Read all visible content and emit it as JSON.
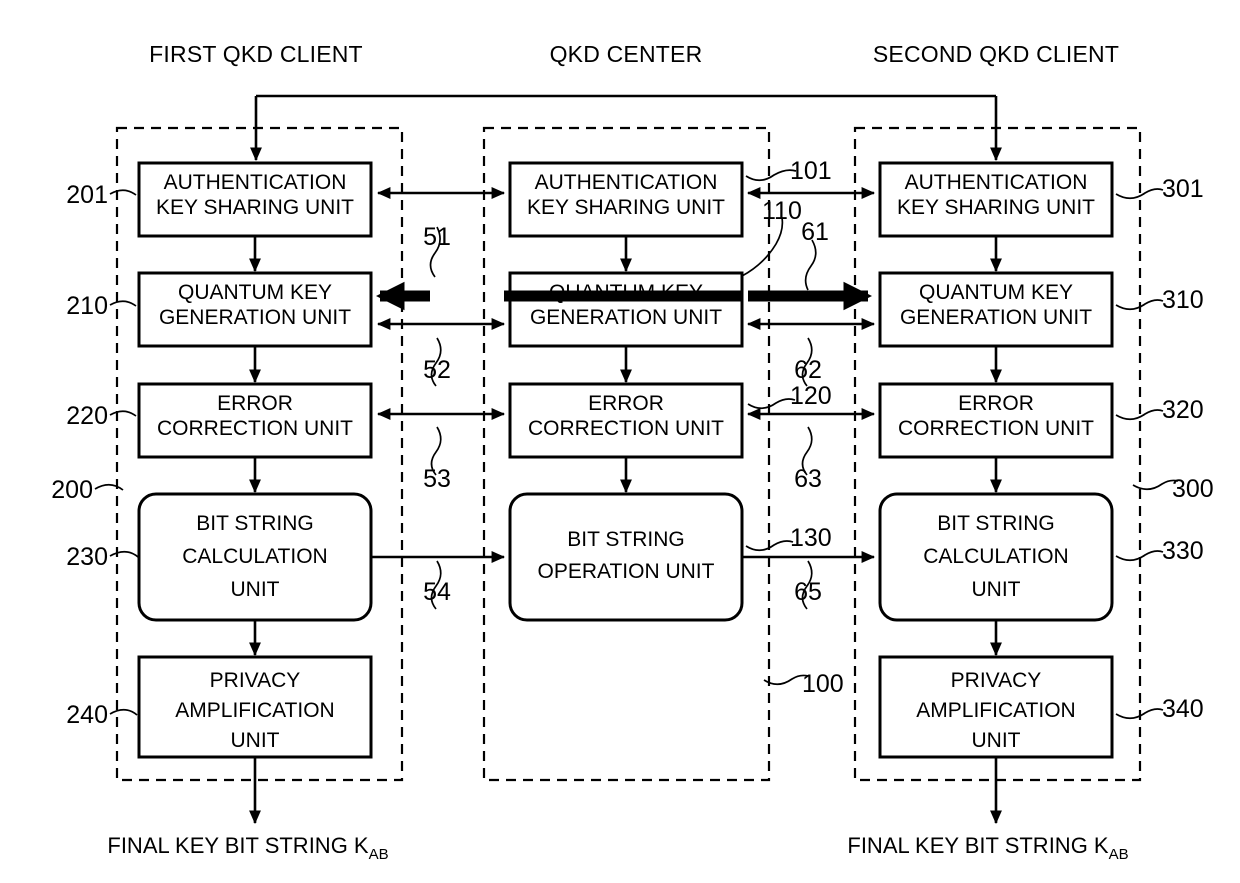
{
  "figure": {
    "title": "QKD system block diagram",
    "columns": [
      {
        "id": "first-client",
        "header": "FIRST QKD CLIENT"
      },
      {
        "id": "qkd-center",
        "header": "QKD CENTER"
      },
      {
        "id": "second-client",
        "header": "SECOND QKD CLIENT"
      }
    ],
    "units": {
      "auth_key_sharing": "AUTHENTICATION\nKEY SHARING UNIT",
      "auth_line1": "AUTHENTICATION",
      "auth_line2": "KEY SHARING UNIT",
      "quantum_line1": "QUANTUM KEY",
      "quantum_line2": "GENERATION UNIT",
      "error_line1": "ERROR",
      "error_line2": "CORRECTION UNIT",
      "bitcalc_line1": "BIT STRING",
      "bitcalc_line2": "CALCULATION",
      "bitcalc_line3": "UNIT",
      "bitop_line1": "BIT STRING",
      "bitop_line2": "OPERATION UNIT",
      "privacy_line1": "PRIVACY",
      "privacy_line2": "AMPLIFICATION",
      "privacy_line3": "UNIT"
    },
    "reference_numerals": {
      "left_client_group": "200",
      "left_auth": "201",
      "left_quantum": "210",
      "left_error": "220",
      "left_bitcalc": "230",
      "left_privacy": "240",
      "center_group": "100",
      "center_auth": "101",
      "center_quantum": "110",
      "center_error": "120",
      "center_bitop": "130",
      "right_client_group": "300",
      "right_auth": "301",
      "right_quantum": "310",
      "right_error": "320",
      "right_bitcalc": "330",
      "right_privacy": "340",
      "link_51": "51",
      "link_52": "52",
      "link_53": "53",
      "link_54": "54",
      "link_61": "61",
      "link_62": "62",
      "link_63": "63",
      "link_65": "65"
    },
    "outputs": {
      "final_key_text": "FINAL KEY BIT STRING K",
      "final_key_subscript": "AB"
    },
    "colors": {
      "stroke": "#000000",
      "background": "#ffffff"
    }
  }
}
